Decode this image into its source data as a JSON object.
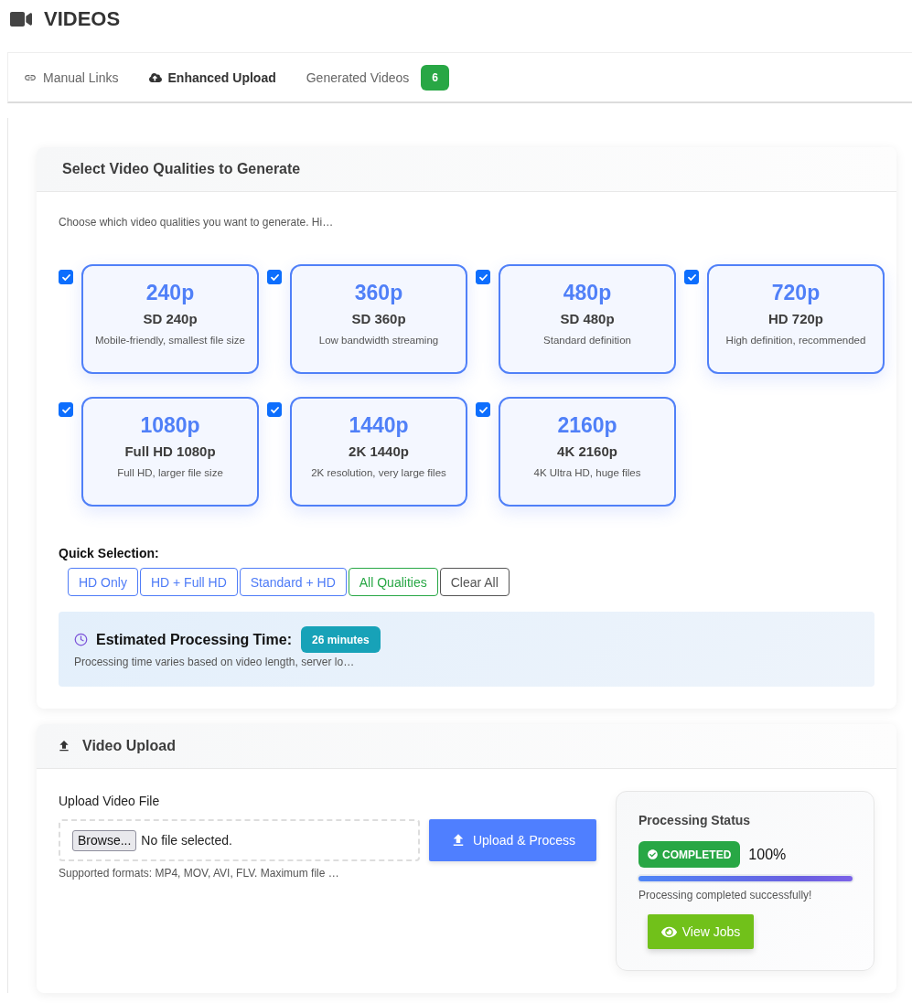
{
  "header": {
    "title": "VIDEOS"
  },
  "tabs": [
    {
      "label": "Manual Links",
      "selected": false
    },
    {
      "label": "Enhanced Upload",
      "selected": true
    },
    {
      "label": "Generated Videos",
      "badge": "6",
      "selected": false
    }
  ],
  "quality_section": {
    "title": "Select Video Qualities to Generate",
    "description": "Choose which video qualities you want to generate. Hi…",
    "qualities": [
      {
        "resolution": "240p",
        "name": "SD 240p",
        "description": "Mobile-friendly, smallest file size",
        "checked": true
      },
      {
        "resolution": "360p",
        "name": "SD 360p",
        "description": "Low bandwidth streaming",
        "checked": true
      },
      {
        "resolution": "480p",
        "name": "SD 480p",
        "description": "Standard definition",
        "checked": true
      },
      {
        "resolution": "720p",
        "name": "HD 720p",
        "description": "High definition, recommended",
        "checked": true
      },
      {
        "resolution": "1080p",
        "name": "Full HD 1080p",
        "description": "Full HD, larger file size",
        "checked": true
      },
      {
        "resolution": "1440p",
        "name": "2K 1440p",
        "description": "2K resolution, very large files",
        "checked": true
      },
      {
        "resolution": "2160p",
        "name": "4K 2160p",
        "description": "4K Ultra HD, huge files",
        "checked": true
      }
    ],
    "quick_selection": {
      "label": "Quick Selection:",
      "buttons": [
        {
          "label": "HD Only",
          "color": "#4f7cf7"
        },
        {
          "label": "HD + Full HD",
          "color": "#4f7cf7"
        },
        {
          "label": "Standard + HD",
          "color": "#4f7cf7"
        },
        {
          "label": "All Qualities",
          "color": "#28a745"
        },
        {
          "label": "Clear All",
          "color": "#555555"
        }
      ]
    },
    "estimate": {
      "title": "Estimated Processing Time:",
      "value": "26 minutes",
      "note": "Processing time varies based on video length, server lo…"
    }
  },
  "upload_section": {
    "title": "Video Upload",
    "field_label": "Upload Video File",
    "browse_button": "Browse...",
    "file_status": "No file selected.",
    "submit_button": "Upload & Process",
    "hint": "Supported formats: MP4, MOV, AVI, FLV. Maximum file …"
  },
  "status": {
    "title": "Processing Status",
    "badge": "COMPLETED",
    "percent": "100%",
    "level": 1,
    "message": "Processing completed successfully!",
    "button": "View Jobs"
  }
}
